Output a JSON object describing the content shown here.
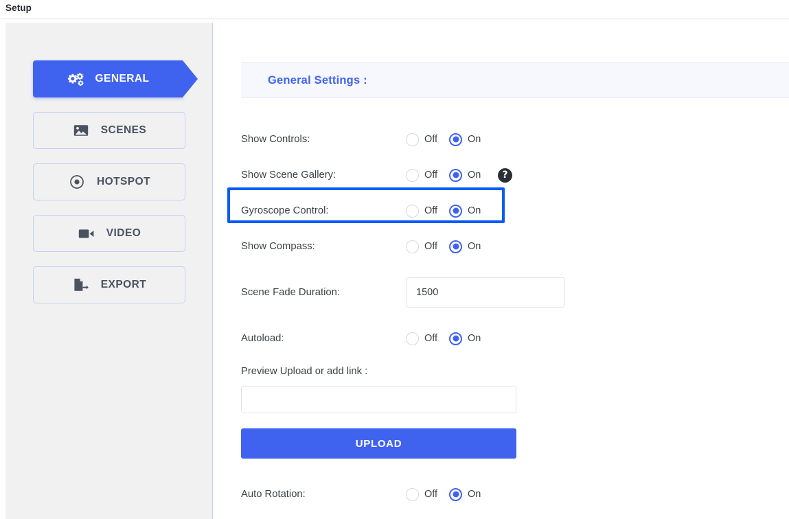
{
  "topbar": {
    "title": "Setup"
  },
  "sidebar": {
    "items": [
      {
        "label": "GENERAL",
        "icon": "gears-icon",
        "active": true
      },
      {
        "label": "SCENES",
        "icon": "image-icon",
        "active": false
      },
      {
        "label": "HOTSPOT",
        "icon": "target-dot-icon",
        "active": false
      },
      {
        "label": "VIDEO",
        "icon": "video-camera-icon",
        "active": false
      },
      {
        "label": "EXPORT",
        "icon": "file-export-icon",
        "active": false
      }
    ]
  },
  "main": {
    "section_title": "General Settings :",
    "settings": [
      {
        "label": "Show Controls:",
        "off_label": "Off",
        "on_label": "On",
        "selected": "On",
        "help": false
      },
      {
        "label": "Show Scene Gallery:",
        "off_label": "Off",
        "on_label": "On",
        "selected": "On",
        "help": true,
        "help_glyph": "?"
      },
      {
        "label": "Gyroscope Control:",
        "off_label": "Off",
        "on_label": "On",
        "selected": "On",
        "help": false,
        "highlighted": true
      },
      {
        "label": "Show Compass:",
        "off_label": "Off",
        "on_label": "On",
        "selected": "On",
        "help": false
      }
    ],
    "scene_fade": {
      "label": "Scene Fade Duration:",
      "value": "1500",
      "placeholder": ""
    },
    "autoload": {
      "label": "Autoload:",
      "off_label": "Off",
      "on_label": "On",
      "selected": "On"
    },
    "preview_upload": {
      "caption": "Preview Upload or add link :",
      "value": "",
      "placeholder": "",
      "button_label": "UPLOAD"
    },
    "auto_rotation": {
      "label": "Auto Rotation:",
      "off_label": "Off",
      "on_label": "On",
      "selected": "On"
    }
  },
  "colors": {
    "accent": "#4063ef",
    "highlight": "#0b5cf5",
    "sidebar_bg": "#f1f1f1",
    "header_bg": "#f7f8fd",
    "text": "#3b4046"
  }
}
